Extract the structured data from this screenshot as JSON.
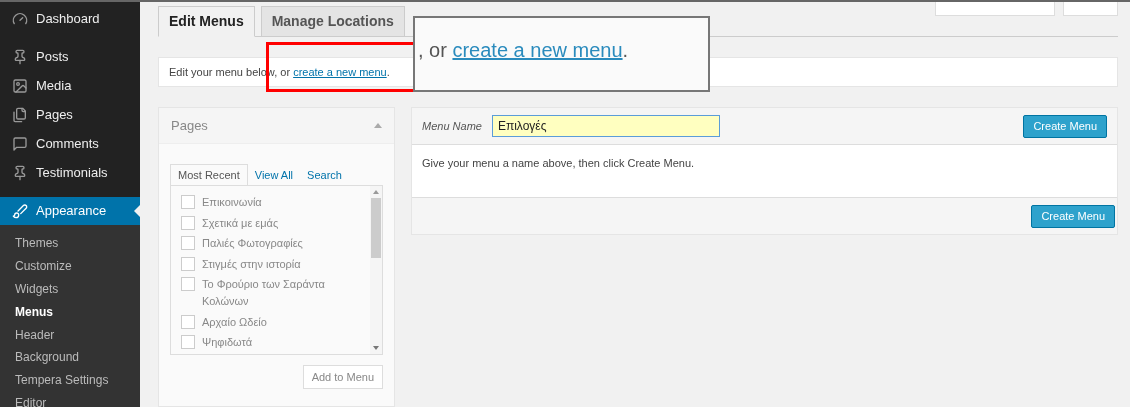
{
  "sidebar": {
    "items": [
      {
        "label": "Dashboard",
        "selected": false
      },
      {
        "label": "Posts",
        "selected": false
      },
      {
        "label": "Media",
        "selected": false
      },
      {
        "label": "Pages",
        "selected": false
      },
      {
        "label": "Comments",
        "selected": false
      },
      {
        "label": "Testimonials",
        "selected": false
      },
      {
        "label": "Appearance",
        "selected": true
      }
    ],
    "submenu": [
      {
        "label": "Themes",
        "selected": false
      },
      {
        "label": "Customize",
        "selected": false
      },
      {
        "label": "Widgets",
        "selected": false
      },
      {
        "label": "Menus",
        "selected": true
      },
      {
        "label": "Header",
        "selected": false
      },
      {
        "label": "Background",
        "selected": false
      },
      {
        "label": "Tempera Settings",
        "selected": false
      },
      {
        "label": "Editor",
        "selected": false
      }
    ]
  },
  "tabs": [
    {
      "label": "Edit Menus",
      "selected": true
    },
    {
      "label": "Manage Locations",
      "selected": false
    }
  ],
  "notice": {
    "text": "Edit your menu below, or ",
    "link": "create a new menu",
    "end": "."
  },
  "magnifier": {
    "text": ", or ",
    "link": "create a new menu",
    "end": "."
  },
  "pages_panel": {
    "title": "Pages",
    "disabled": true,
    "tabs": [
      {
        "label": "Most Recent",
        "selected": true
      },
      {
        "label": "View All",
        "selected": false
      },
      {
        "label": "Search",
        "selected": false
      }
    ],
    "items": [
      {
        "label": "Επικοινωνία",
        "checked": false
      },
      {
        "label": "Σχετικά με εμάς",
        "checked": false
      },
      {
        "label": "Παλιές Φωτογραφίες",
        "checked": false
      },
      {
        "label": "Στιγμές στην ιστορία",
        "checked": false
      },
      {
        "label": "Το Φρούριο των Σαράντα Κολώνων",
        "checked": false
      },
      {
        "label": "Αρχαίο Ωδείο",
        "checked": false
      },
      {
        "label": "Ψηφιδωτά",
        "checked": false
      }
    ],
    "button": "Add to Menu"
  },
  "menu_editor": {
    "label": "Menu Name",
    "value": "Επιλογές",
    "button_top": "Create Menu",
    "hint": "Give your menu a name above, then click Create Menu.",
    "button_bottom": "Create Menu"
  }
}
